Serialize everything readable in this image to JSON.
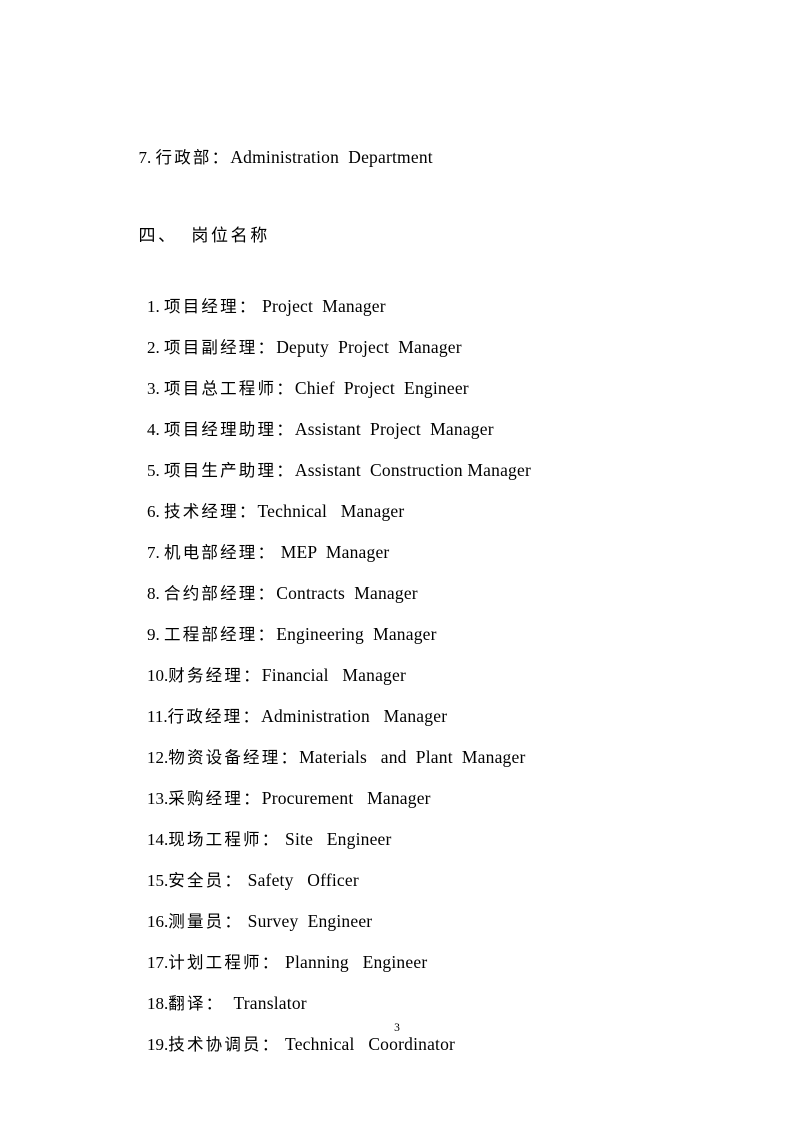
{
  "document": {
    "page_number": "3",
    "intro_line": {
      "number": "7.",
      "chinese": "行政部",
      "colon": "：",
      "english": "Administration  Department"
    },
    "section_heading": {
      "number": "四、",
      "title": "岗位名称"
    },
    "positions": [
      {
        "number": "1.",
        "sep": " ",
        "chinese": "项目经理",
        "colon": "：",
        "english": " Project  Manager"
      },
      {
        "number": "2.",
        "sep": " ",
        "chinese": "项目副经理",
        "colon": "：",
        "english": "Deputy  Project  Manager"
      },
      {
        "number": "3.",
        "sep": " ",
        "chinese": "项目总工程师",
        "colon": "：",
        "english": "Chief  Project  Engineer"
      },
      {
        "number": "4.",
        "sep": " ",
        "chinese": "项目经理助理",
        "colon": "：",
        "english": "Assistant  Project  Manager"
      },
      {
        "number": "5.",
        "sep": " ",
        "chinese": "项目生产助理",
        "colon": "：",
        "english": "Assistant  Construction Manager"
      },
      {
        "number": "6.",
        "sep": " ",
        "chinese": "技术经理",
        "colon": "：",
        "english": "Technical   Manager"
      },
      {
        "number": "7.",
        "sep": " ",
        "chinese": "机电部经理",
        "colon": "：",
        "english": " MEP  Manager"
      },
      {
        "number": "8.",
        "sep": " ",
        "chinese": "合约部经理",
        "colon": "：",
        "english": "Contracts  Manager"
      },
      {
        "number": "9.",
        "sep": " ",
        "chinese": "工程部经理",
        "colon": "：",
        "english": "Engineering  Manager"
      },
      {
        "number": "10.",
        "sep": "",
        "chinese": "财务经理",
        "colon": "：",
        "english": "Financial   Manager"
      },
      {
        "number": "11.",
        "sep": "",
        "chinese": "行政经理",
        "colon": "：",
        "english": "Administration   Manager"
      },
      {
        "number": "12.",
        "sep": "",
        "chinese": "物资设备经理",
        "colon": "：",
        "english": "Materials   and  Plant  Manager"
      },
      {
        "number": "13.",
        "sep": "",
        "chinese": "采购经理",
        "colon": "：",
        "english": "Procurement   Manager"
      },
      {
        "number": "14.",
        "sep": "",
        "chinese": "现场工程师",
        "colon": "：",
        "english": " Site   Engineer"
      },
      {
        "number": "15.",
        "sep": "",
        "chinese": "安全员",
        "colon": "：",
        "english": " Safety   Officer"
      },
      {
        "number": "16.",
        "sep": "",
        "chinese": "测量员",
        "colon": "：",
        "english": " Survey  Engineer"
      },
      {
        "number": "17.",
        "sep": "",
        "chinese": "计划工程师",
        "colon": "：",
        "english": " Planning   Engineer"
      },
      {
        "number": "18.",
        "sep": "",
        "chinese": "翻译",
        "colon": "：",
        "english": "  Translator"
      },
      {
        "number": "19.",
        "sep": "",
        "chinese": "技术协调员",
        "colon": "：",
        "english": " Technical   Coordinator"
      }
    ]
  }
}
